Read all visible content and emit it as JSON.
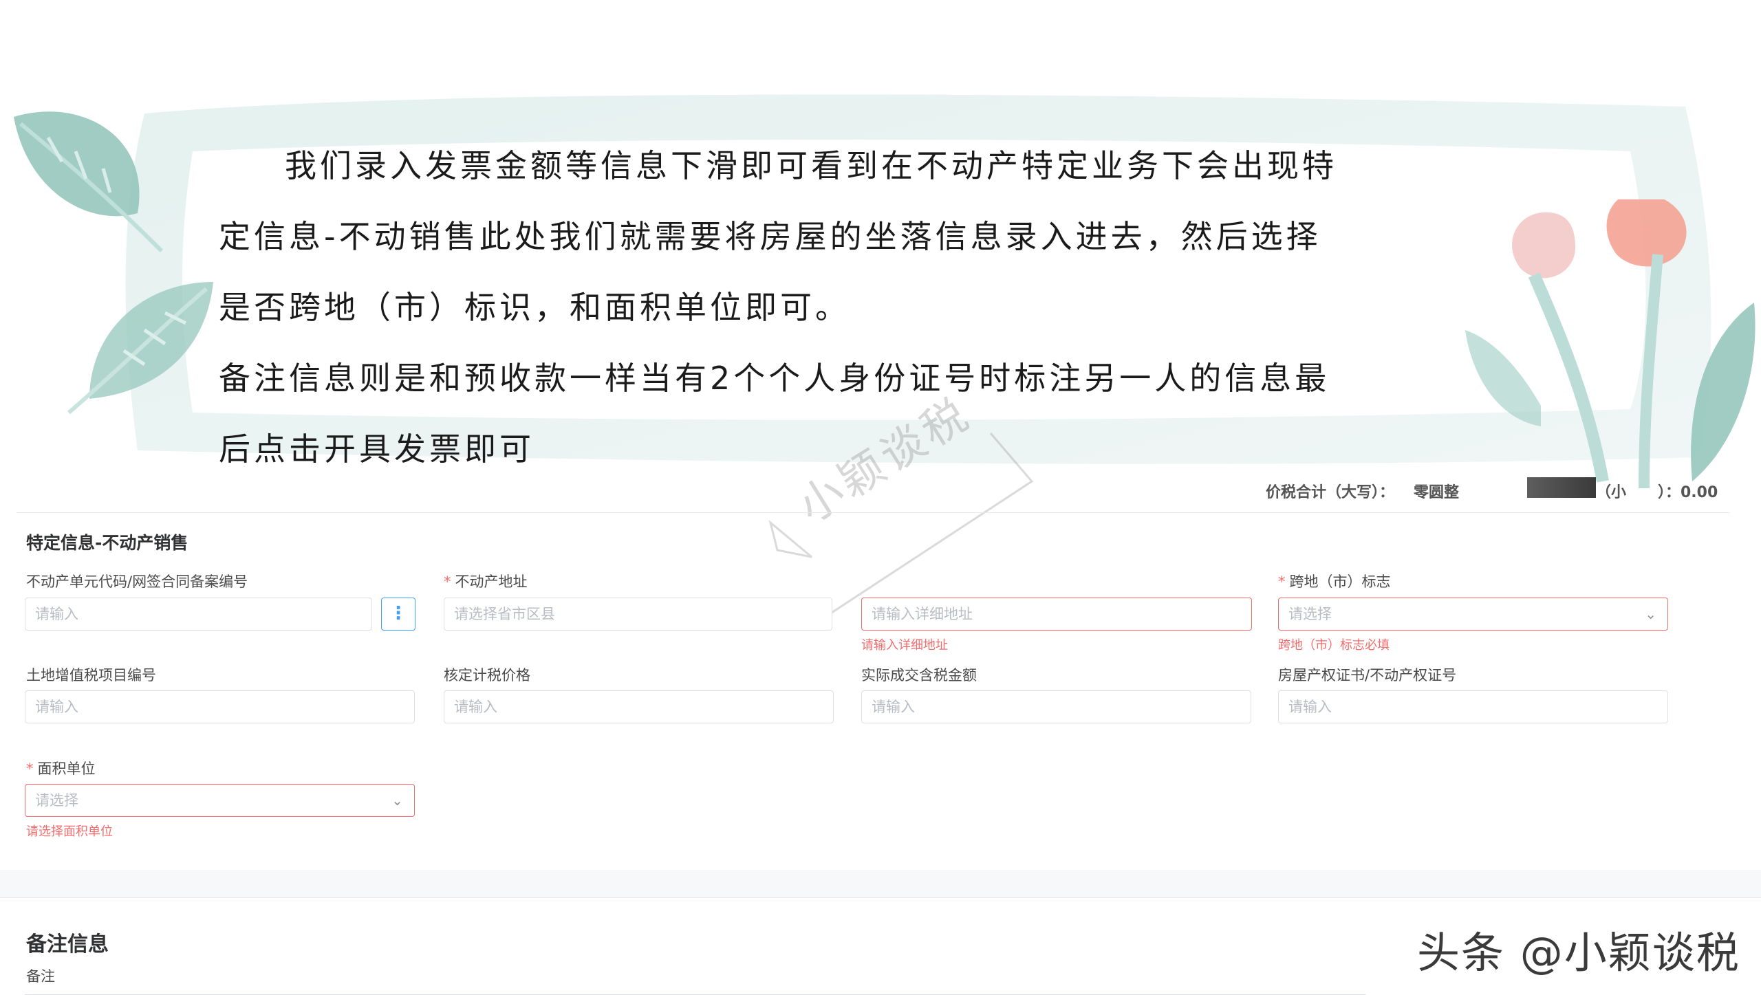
{
  "intro": {
    "line1": "我们录入发票金额等信息下滑即可看到在不动产特定业务下会出现特",
    "line2": "定信息-不动销售此处我们就需要将房屋的坐落信息录入进去，然后选择",
    "line3": "是否跨地（市）标识，和面积单位即可。",
    "line4": "备注信息则是和预收款一样当有2个个人身份证号时标注另一人的信息最",
    "line5": "后点击开具发票即可"
  },
  "watermark": "小颖谈税",
  "totals": {
    "capital_label": "价税合计（大写）：",
    "capital_value": "零圆整",
    "small_label": "（小",
    "small_value": "）：0.00"
  },
  "special_section": {
    "title": "特定信息-不动产销售",
    "fields": {
      "unit_code": {
        "label": "不动产单元代码/网签合同备案编号",
        "placeholder": "请输入"
      },
      "address": {
        "label": "不动产地址",
        "region_placeholder": "请选择省市区县",
        "detail_placeholder": "请输入详细地址",
        "detail_error": "请输入详细地址"
      },
      "cross_region": {
        "label": "跨地（市）标志",
        "placeholder": "请选择",
        "error": "跨地（市）标志必填"
      },
      "land_tax_no": {
        "label": "土地增值税项目编号",
        "placeholder": "请输入"
      },
      "assessed_price": {
        "label": "核定计税价格",
        "placeholder": "请输入"
      },
      "actual_amount": {
        "label": "实际成交含税金额",
        "placeholder": "请输入"
      },
      "property_cert": {
        "label": "房屋产权证书/不动产权证号",
        "placeholder": "请输入"
      },
      "area_unit": {
        "label": "面积单位",
        "placeholder": "请选择",
        "error": "请选择面积单位"
      }
    }
  },
  "remarks_section": {
    "title": "备注信息",
    "label": "备注"
  },
  "signature": "头条 @小颖谈税",
  "colors": {
    "error": "#f56c6c",
    "primary": "#409eff",
    "border": "#dcdfe6"
  }
}
